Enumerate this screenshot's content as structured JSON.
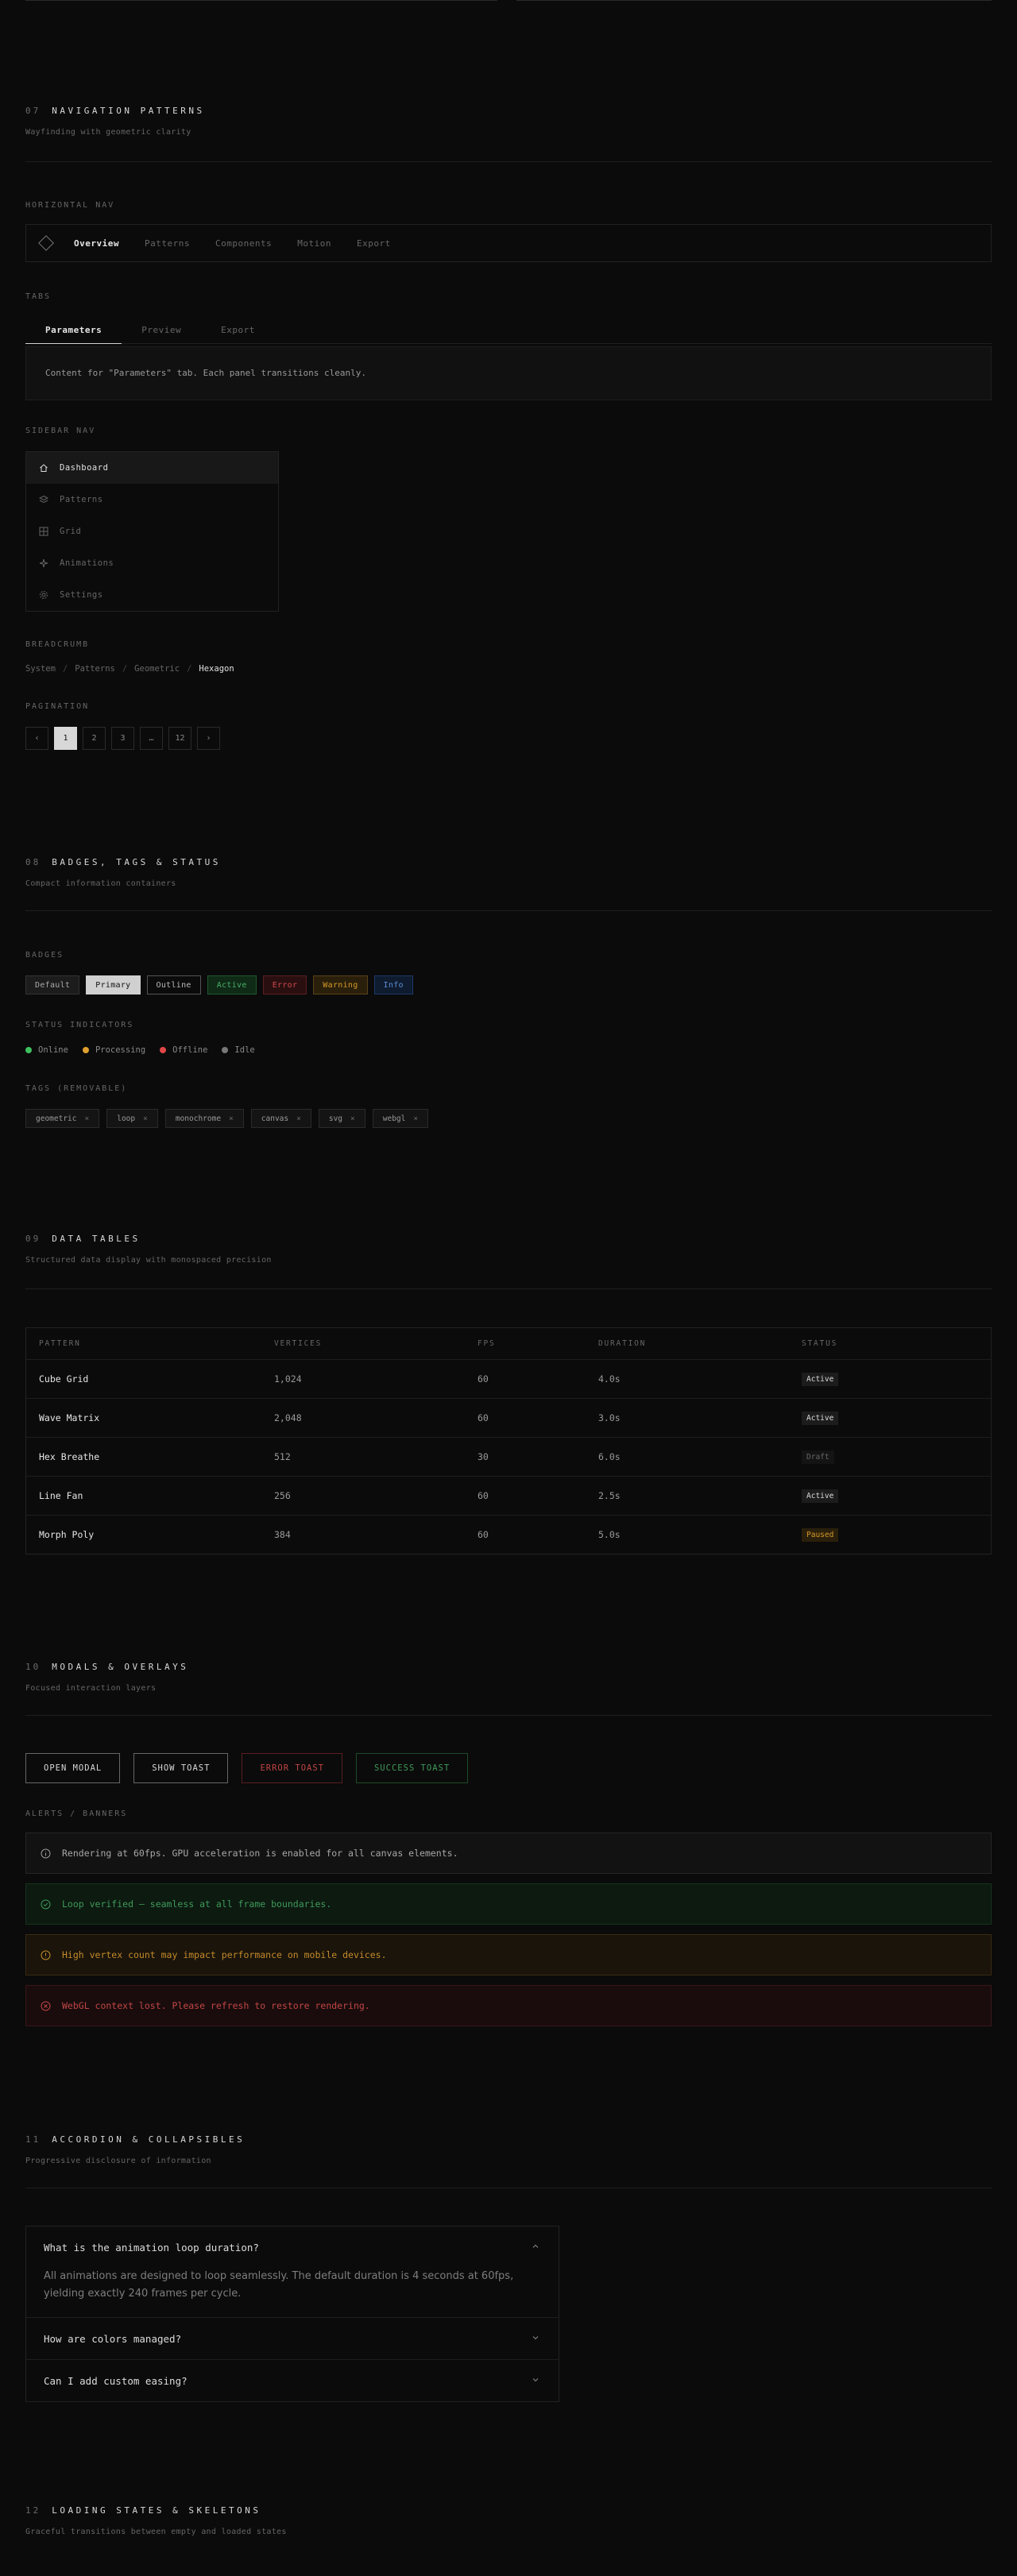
{
  "nav_section": {
    "num": "07",
    "title": "NAVIGATION PATTERNS",
    "subtitle": "Wayfinding with geometric clarity",
    "horizontal_label": "HORIZONTAL NAV",
    "horizontal_items": [
      "Overview",
      "Patterns",
      "Components",
      "Motion",
      "Export"
    ],
    "tabs_label": "TABS",
    "tabs": [
      "Parameters",
      "Preview",
      "Export"
    ],
    "tab_content": "Content for \"Parameters\" tab. Each panel transitions cleanly.",
    "sidebar_label": "SIDEBAR NAV",
    "sidebar_items": [
      {
        "label": "Dashboard",
        "icon": "home-icon"
      },
      {
        "label": "Patterns",
        "icon": "layers-icon"
      },
      {
        "label": "Grid",
        "icon": "grid-icon"
      },
      {
        "label": "Animations",
        "icon": "sparkle-icon"
      },
      {
        "label": "Settings",
        "icon": "gear-icon"
      }
    ],
    "breadcrumb_label": "BREADCRUMB",
    "breadcrumb": [
      "System",
      "Patterns",
      "Geometric",
      "Hexagon"
    ],
    "breadcrumb_sep": "/",
    "pagination_label": "PAGINATION",
    "pagination": [
      "‹",
      "1",
      "2",
      "3",
      "…",
      "12",
      "›"
    ]
  },
  "badges_section": {
    "num": "08",
    "title": "BADGES, TAGS & STATUS",
    "subtitle": "Compact information containers",
    "badges_label": "BADGES",
    "badges": [
      "Default",
      "Primary",
      "Outline",
      "Active",
      "Error",
      "Warning",
      "Info"
    ],
    "status_label": "STATUS INDICATORS",
    "statuses": [
      {
        "label": "Online",
        "color": "#3fbf5f"
      },
      {
        "label": "Processing",
        "color": "#e0a030"
      },
      {
        "label": "Offline",
        "color": "#e04848"
      },
      {
        "label": "Idle",
        "color": "#777777"
      }
    ],
    "tags_label": "TAGS (REMOVABLE)",
    "tags": [
      "geometric",
      "loop",
      "monochrome",
      "canvas",
      "svg",
      "webgl"
    ],
    "tag_remove": "×"
  },
  "tables_section": {
    "num": "09",
    "title": "DATA TABLES",
    "subtitle": "Structured data display with monospaced precision",
    "headers": [
      "PATTERN",
      "VERTICES",
      "FPS",
      "DURATION",
      "STATUS"
    ],
    "rows": [
      {
        "pattern": "Cube Grid",
        "vertices": "1,024",
        "fps": "60",
        "duration": "4.0s",
        "status": "Active"
      },
      {
        "pattern": "Wave Matrix",
        "vertices": "2,048",
        "fps": "60",
        "duration": "3.0s",
        "status": "Active"
      },
      {
        "pattern": "Hex Breathe",
        "vertices": "512",
        "fps": "30",
        "duration": "6.0s",
        "status": "Draft"
      },
      {
        "pattern": "Line Fan",
        "vertices": "256",
        "fps": "60",
        "duration": "2.5s",
        "status": "Active"
      },
      {
        "pattern": "Morph Poly",
        "vertices": "384",
        "fps": "60",
        "duration": "5.0s",
        "status": "Paused"
      }
    ]
  },
  "modals_section": {
    "num": "10",
    "title": "MODALS & OVERLAYS",
    "subtitle": "Focused interaction layers",
    "buttons": [
      "OPEN MODAL",
      "SHOW TOAST",
      "ERROR TOAST",
      "SUCCESS TOAST"
    ],
    "alerts_label": "ALERTS / BANNERS",
    "alerts": [
      {
        "type": "info",
        "text": "Rendering at 60fps. GPU acceleration is enabled for all canvas elements."
      },
      {
        "type": "ok",
        "text": "Loop verified — seamless at all frame boundaries."
      },
      {
        "type": "warn",
        "text": "High vertex count may impact performance on mobile devices."
      },
      {
        "type": "err",
        "text": "WebGL context lost. Please refresh to restore rendering."
      }
    ]
  },
  "accordion_section": {
    "num": "11",
    "title": "ACCORDION & COLLAPSIBLES",
    "subtitle": "Progressive disclosure of information",
    "items": [
      {
        "q": "What is the animation loop duration?",
        "a": "All animations are designed to loop seamlessly. The default duration is 4 seconds at 60fps, yielding exactly 240 frames per cycle.",
        "open": true
      },
      {
        "q": "How are colors managed?",
        "a": "",
        "open": false
      },
      {
        "q": "Can I add custom easing?",
        "a": "",
        "open": false
      }
    ]
  },
  "loading_section": {
    "num": "12",
    "title": "LOADING STATES & SKELETONS",
    "subtitle": "Graceful transitions between empty and loaded states"
  }
}
